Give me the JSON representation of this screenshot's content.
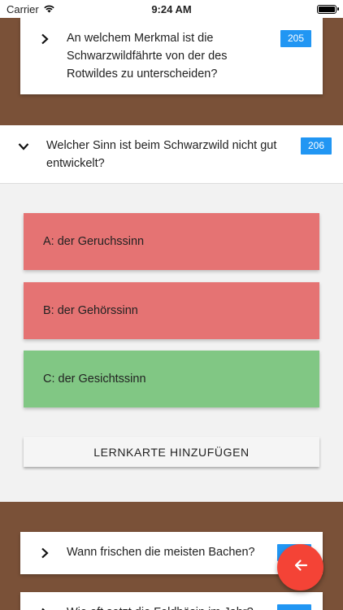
{
  "status_bar": {
    "carrier": "Carrier",
    "time": "9:24 AM"
  },
  "questions": [
    {
      "text": "An welchem Merkmal ist die Schwarzwildfährte von der des Rotwildes zu unterscheiden?",
      "number": "205"
    },
    {
      "text": "Welcher Sinn ist beim Schwarzwild nicht gut entwickelt?",
      "number": "206"
    },
    {
      "text": "Wann frischen die meisten Bachen?",
      "number": ""
    },
    {
      "text": "Wie oft setzt die Feldhäsin im Jahr?",
      "number": ""
    }
  ],
  "expanded": {
    "answers": [
      {
        "label": "A: der Geruchssinn",
        "state": "wrong"
      },
      {
        "label": "B: der Gehörssinn",
        "state": "wrong"
      },
      {
        "label": "C: der Gesichtssinn",
        "state": "right"
      }
    ],
    "add_button_label": "LERNKARTE HINZUFÜGEN"
  },
  "colors": {
    "background": "#7a5138",
    "badge": "#2196f3",
    "wrong": "#e57373",
    "right": "#81c784",
    "fab": "#f44336"
  },
  "icons": {
    "collapsed": "chevron-right-icon",
    "expanded": "chevron-down-icon",
    "fab": "arrow-left-icon"
  }
}
